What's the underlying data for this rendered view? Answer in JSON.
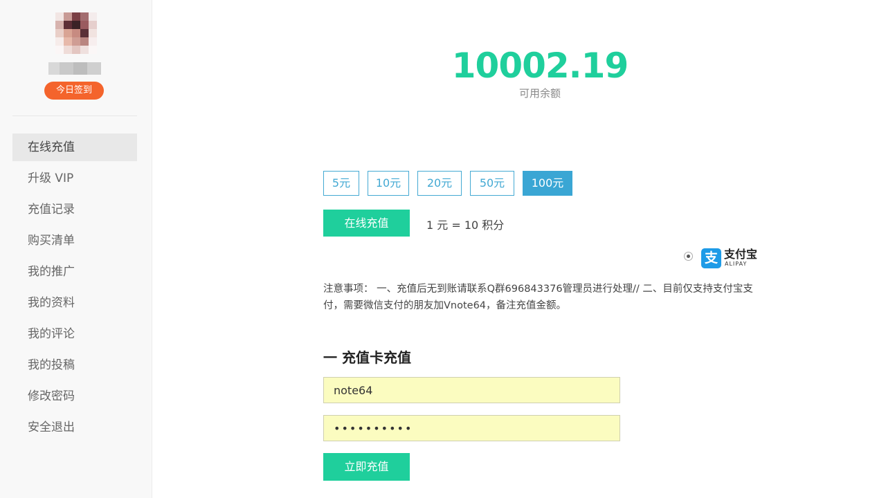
{
  "sidebar": {
    "checkin_label": "今日签到",
    "items": [
      {
        "label": "在线充值",
        "active": true
      },
      {
        "label": "升级 VIP",
        "active": false
      },
      {
        "label": "充值记录",
        "active": false
      },
      {
        "label": "购买清单",
        "active": false
      },
      {
        "label": "我的推广",
        "active": false
      },
      {
        "label": "我的资料",
        "active": false
      },
      {
        "label": "我的评论",
        "active": false
      },
      {
        "label": "我的投稿",
        "active": false
      },
      {
        "label": "修改密码",
        "active": false
      },
      {
        "label": "安全退出",
        "active": false
      }
    ]
  },
  "balance": {
    "amount": "10002.19",
    "label": "可用余额"
  },
  "recharge": {
    "amounts": [
      "5元",
      "10元",
      "20元",
      "50元",
      "100元"
    ],
    "selected_amount": "100元",
    "pay_button": "在线充值",
    "rate_text": "1 元 = 10 积分",
    "payment_method": {
      "brand_cn": "支付宝",
      "brand_en": "ALIPAY",
      "icon_glyph": "支",
      "selected": true
    },
    "notice": "注意事项： 一、充值后无到账请联系Q群696843376管理员进行处理// 二、目前仅支持支付宝支付，需要微信支付的朋友加Vnote64，备注充值金额。"
  },
  "card_recharge": {
    "title": "一 充值卡充值",
    "card_number": "note64",
    "card_password": "••••••••••",
    "submit_button": "立即充值"
  },
  "colors": {
    "accent_green": "#1fcf9c",
    "accent_blue": "#3aa6d4",
    "checkin_orange": "#f4642c",
    "input_fill": "#fbfcc0"
  }
}
